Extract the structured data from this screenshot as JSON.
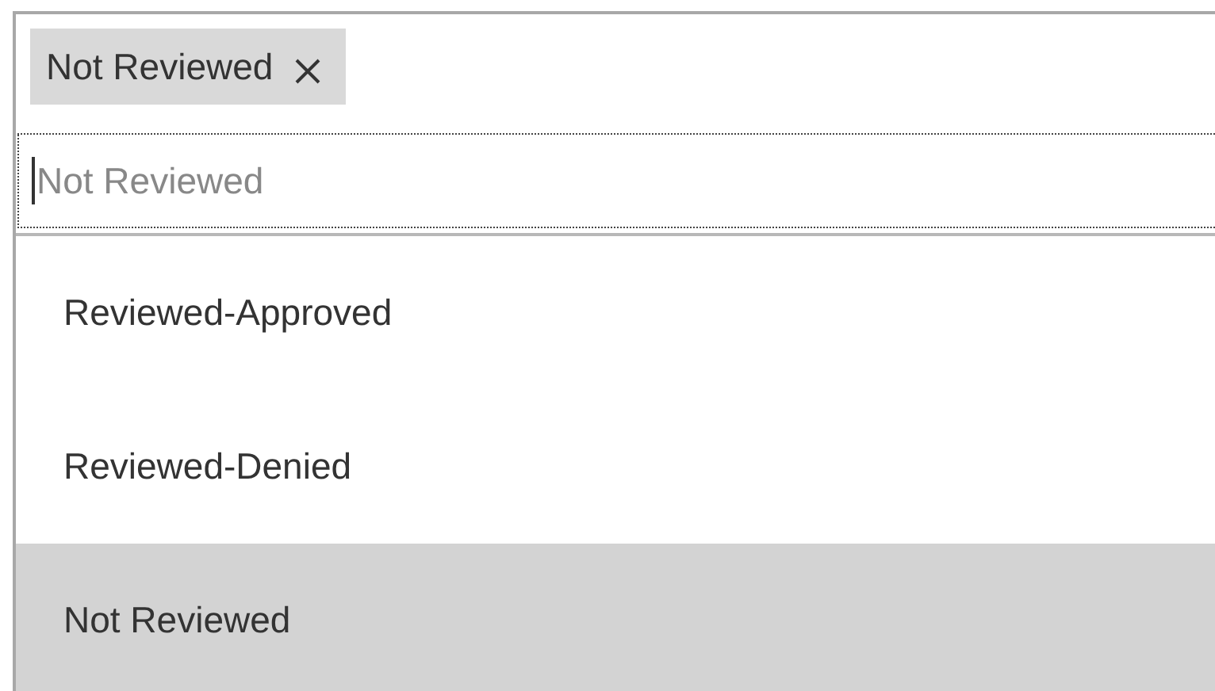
{
  "tags": [
    {
      "label": "Not Reviewed"
    }
  ],
  "search": {
    "placeholder": "Not Reviewed"
  },
  "options": [
    {
      "label": "Reviewed-Approved",
      "selected": false
    },
    {
      "label": "Reviewed-Denied",
      "selected": false
    },
    {
      "label": "Not Reviewed",
      "selected": true
    }
  ]
}
